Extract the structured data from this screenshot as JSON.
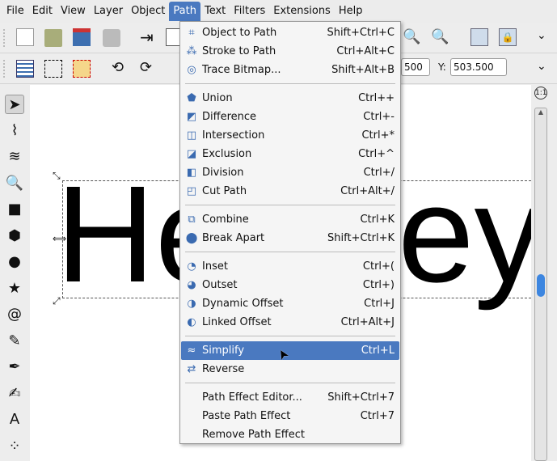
{
  "menubar": [
    "File",
    "Edit",
    "View",
    "Layer",
    "Object",
    "Path",
    "Text",
    "Filters",
    "Extensions",
    "Help"
  ],
  "toolbar2": {
    "x_value": "500",
    "y_label": "Y:",
    "y_value": "503.500"
  },
  "zoom_label": "1:1",
  "canvas": {
    "text_left": "He",
    "text_right": "ey"
  },
  "path_menu": [
    {
      "label": "Object to Path",
      "shortcut": "Shift+Ctrl+C",
      "icon": "object-to-path-icon",
      "glyph": "⌗"
    },
    {
      "label": "Stroke to Path",
      "shortcut": "Ctrl+Alt+C",
      "icon": "stroke-to-path-icon",
      "glyph": "⁂"
    },
    {
      "label": "Trace Bitmap...",
      "shortcut": "Shift+Alt+B",
      "icon": "trace-bitmap-icon",
      "glyph": "◎"
    },
    {
      "sep": true
    },
    {
      "label": "Union",
      "shortcut": "Ctrl++",
      "icon": "union-icon",
      "glyph": "⬟"
    },
    {
      "label": "Difference",
      "shortcut": "Ctrl+-",
      "icon": "difference-icon",
      "glyph": "◩"
    },
    {
      "label": "Intersection",
      "shortcut": "Ctrl+*",
      "icon": "intersection-icon",
      "glyph": "◫"
    },
    {
      "label": "Exclusion",
      "shortcut": "Ctrl+^",
      "icon": "exclusion-icon",
      "glyph": "◪"
    },
    {
      "label": "Division",
      "shortcut": "Ctrl+/",
      "icon": "division-icon",
      "glyph": "◧"
    },
    {
      "label": "Cut Path",
      "shortcut": "Ctrl+Alt+/",
      "icon": "cut-path-icon",
      "glyph": "◰"
    },
    {
      "sep": true
    },
    {
      "label": "Combine",
      "shortcut": "Ctrl+K",
      "icon": "combine-icon",
      "glyph": "⧉"
    },
    {
      "label": "Break Apart",
      "shortcut": "Shift+Ctrl+K",
      "icon": "break-apart-icon",
      "glyph": "⬤"
    },
    {
      "sep": true
    },
    {
      "label": "Inset",
      "shortcut": "Ctrl+(",
      "icon": "inset-icon",
      "glyph": "◔"
    },
    {
      "label": "Outset",
      "shortcut": "Ctrl+)",
      "icon": "outset-icon",
      "glyph": "◕"
    },
    {
      "label": "Dynamic Offset",
      "shortcut": "Ctrl+J",
      "icon": "dynamic-offset-icon",
      "glyph": "◑"
    },
    {
      "label": "Linked Offset",
      "shortcut": "Ctrl+Alt+J",
      "icon": "linked-offset-icon",
      "glyph": "◐"
    },
    {
      "sep": true
    },
    {
      "label": "Simplify",
      "shortcut": "Ctrl+L",
      "icon": "simplify-icon",
      "glyph": "≈",
      "highlight": true
    },
    {
      "label": "Reverse",
      "shortcut": "",
      "icon": "reverse-icon",
      "glyph": "⇄"
    },
    {
      "sep": true
    },
    {
      "label": "Path Effect Editor...",
      "shortcut": "Shift+Ctrl+7",
      "icon": "",
      "glyph": ""
    },
    {
      "label": "Paste Path Effect",
      "shortcut": "Ctrl+7",
      "icon": "",
      "glyph": ""
    },
    {
      "label": "Remove Path Effect",
      "shortcut": "",
      "icon": "",
      "glyph": ""
    }
  ],
  "tools": [
    {
      "name": "selector-tool-icon",
      "glyph": "➤"
    },
    {
      "name": "node-tool-icon",
      "glyph": "⌇"
    },
    {
      "name": "tweak-tool-icon",
      "glyph": "≋"
    },
    {
      "name": "zoom-tool-icon",
      "glyph": "🔍"
    },
    {
      "name": "rect-tool-icon",
      "glyph": "■"
    },
    {
      "name": "box3d-tool-icon",
      "glyph": "⬢"
    },
    {
      "name": "ellipse-tool-icon",
      "glyph": "●"
    },
    {
      "name": "star-tool-icon",
      "glyph": "★"
    },
    {
      "name": "spiral-tool-icon",
      "glyph": "@"
    },
    {
      "name": "pencil-tool-icon",
      "glyph": "✎"
    },
    {
      "name": "pen-tool-icon",
      "glyph": "✒"
    },
    {
      "name": "calligraphy-tool-icon",
      "glyph": "✍"
    },
    {
      "name": "text-tool-icon",
      "glyph": "A"
    },
    {
      "name": "spray-tool-icon",
      "glyph": "⁘"
    }
  ]
}
